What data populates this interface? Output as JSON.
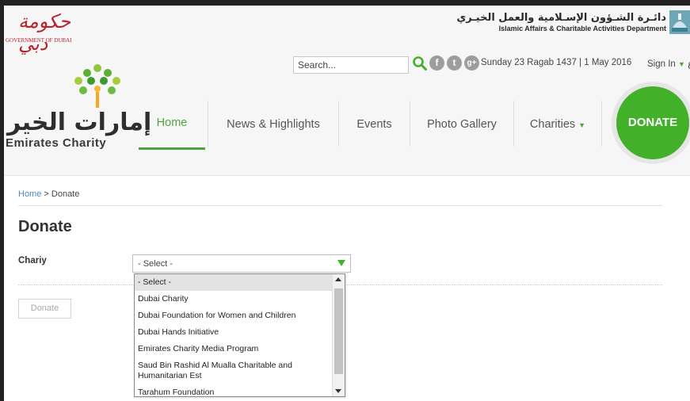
{
  "header": {
    "gov_logo_arabic": "حكومة دبي",
    "gov_logo_latin": "GOVERNMENT OF DUBAI",
    "dept_arabic": "دائـرة الشـؤون الإسـلامية والعمل الخيـري",
    "dept_latin": "Islamic Affairs & Charitable Activities Department",
    "search_placeholder": "Search...",
    "date": "Sunday 23 Ragab 1437 | 1 May 2016",
    "signin": "Sign In",
    "extra_glyph": "ع",
    "brand_arabic": "إمارات الخير",
    "brand_latin": "Emirates Charity"
  },
  "nav": {
    "items": [
      {
        "label": "Home"
      },
      {
        "label": "News & Highlights"
      },
      {
        "label": "Events"
      },
      {
        "label": "Photo Gallery"
      },
      {
        "label": "Charities"
      }
    ],
    "donate": "DONATE"
  },
  "icons": {
    "social": [
      "f",
      "t",
      "g+"
    ]
  },
  "breadcrumb": {
    "home": "Home",
    "separator": " > ",
    "current": "Donate"
  },
  "main": {
    "title": "Donate",
    "field_label": "Chariy",
    "select_value": "- Select -",
    "donate_button": "Donate"
  },
  "dropdown": {
    "options": [
      "- Select -",
      "Dubai Charity",
      "Dubai Foundation for Women and Children",
      "Dubai Hands Initiative",
      "Emirates Charity Media Program",
      "Saud Bin Rashid Al Mualla Charitable and Humanitarian Est",
      "Tarahum Foundation"
    ]
  },
  "colors": {
    "accent": "#43b02a",
    "link": "#4a8dc0",
    "gov_red": "#b8232e"
  }
}
